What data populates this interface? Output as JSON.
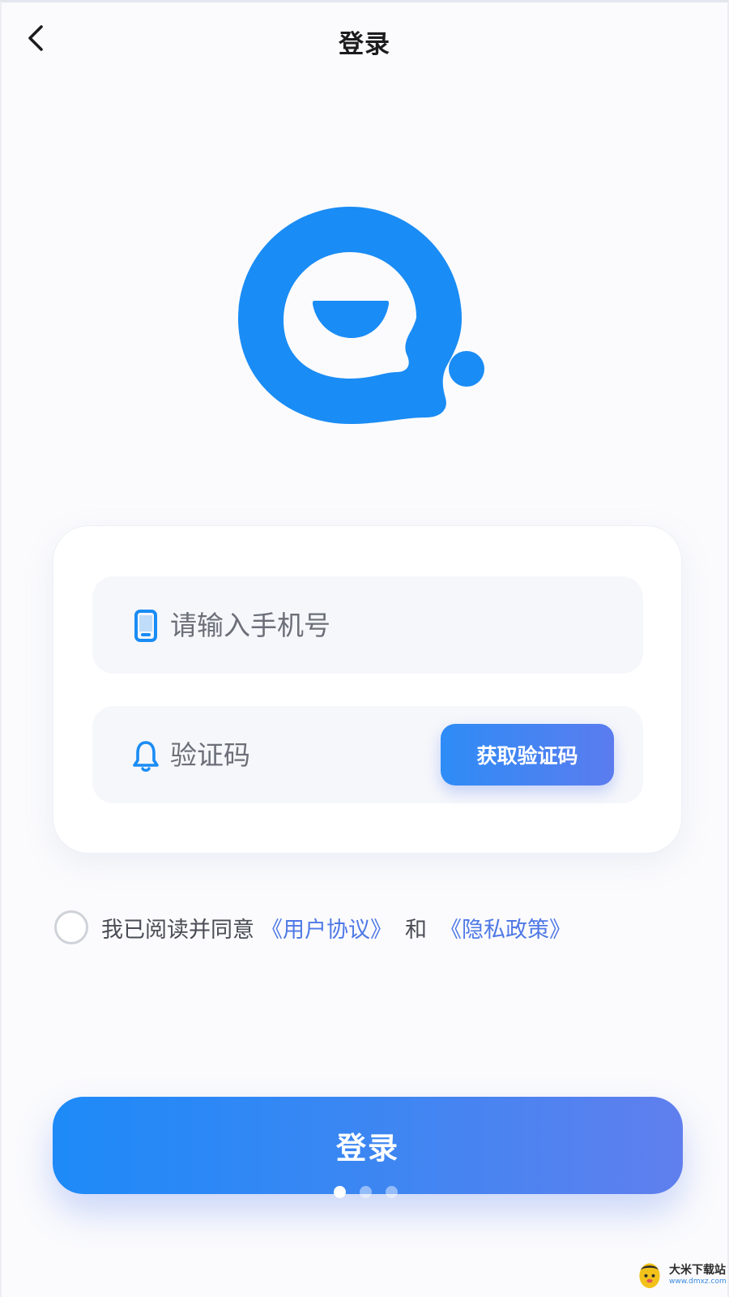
{
  "header": {
    "title": "登录"
  },
  "form": {
    "phone_placeholder": "请输入手机号",
    "code_placeholder": "验证码",
    "get_code_label": "获取验证码"
  },
  "agreement": {
    "prefix": "我已阅读并同意",
    "user_agreement": "《用户协议》",
    "and": "和",
    "privacy_policy": "《隐私政策》"
  },
  "login_button_label": "登录",
  "pager": {
    "count": 3,
    "active_index": 0
  },
  "watermark": {
    "text": "大米下载站",
    "url": "www.dmxz.com"
  },
  "icons": {
    "back": "chevron-left-icon",
    "logo": "chat-bubble-logo",
    "phone": "mobile-phone-icon",
    "code": "bell-icon"
  },
  "colors": {
    "brand_blue": "#1a8cf5",
    "link_blue": "#4f79e6",
    "gradient_start": "#1d8af8",
    "gradient_end": "#607fee"
  }
}
